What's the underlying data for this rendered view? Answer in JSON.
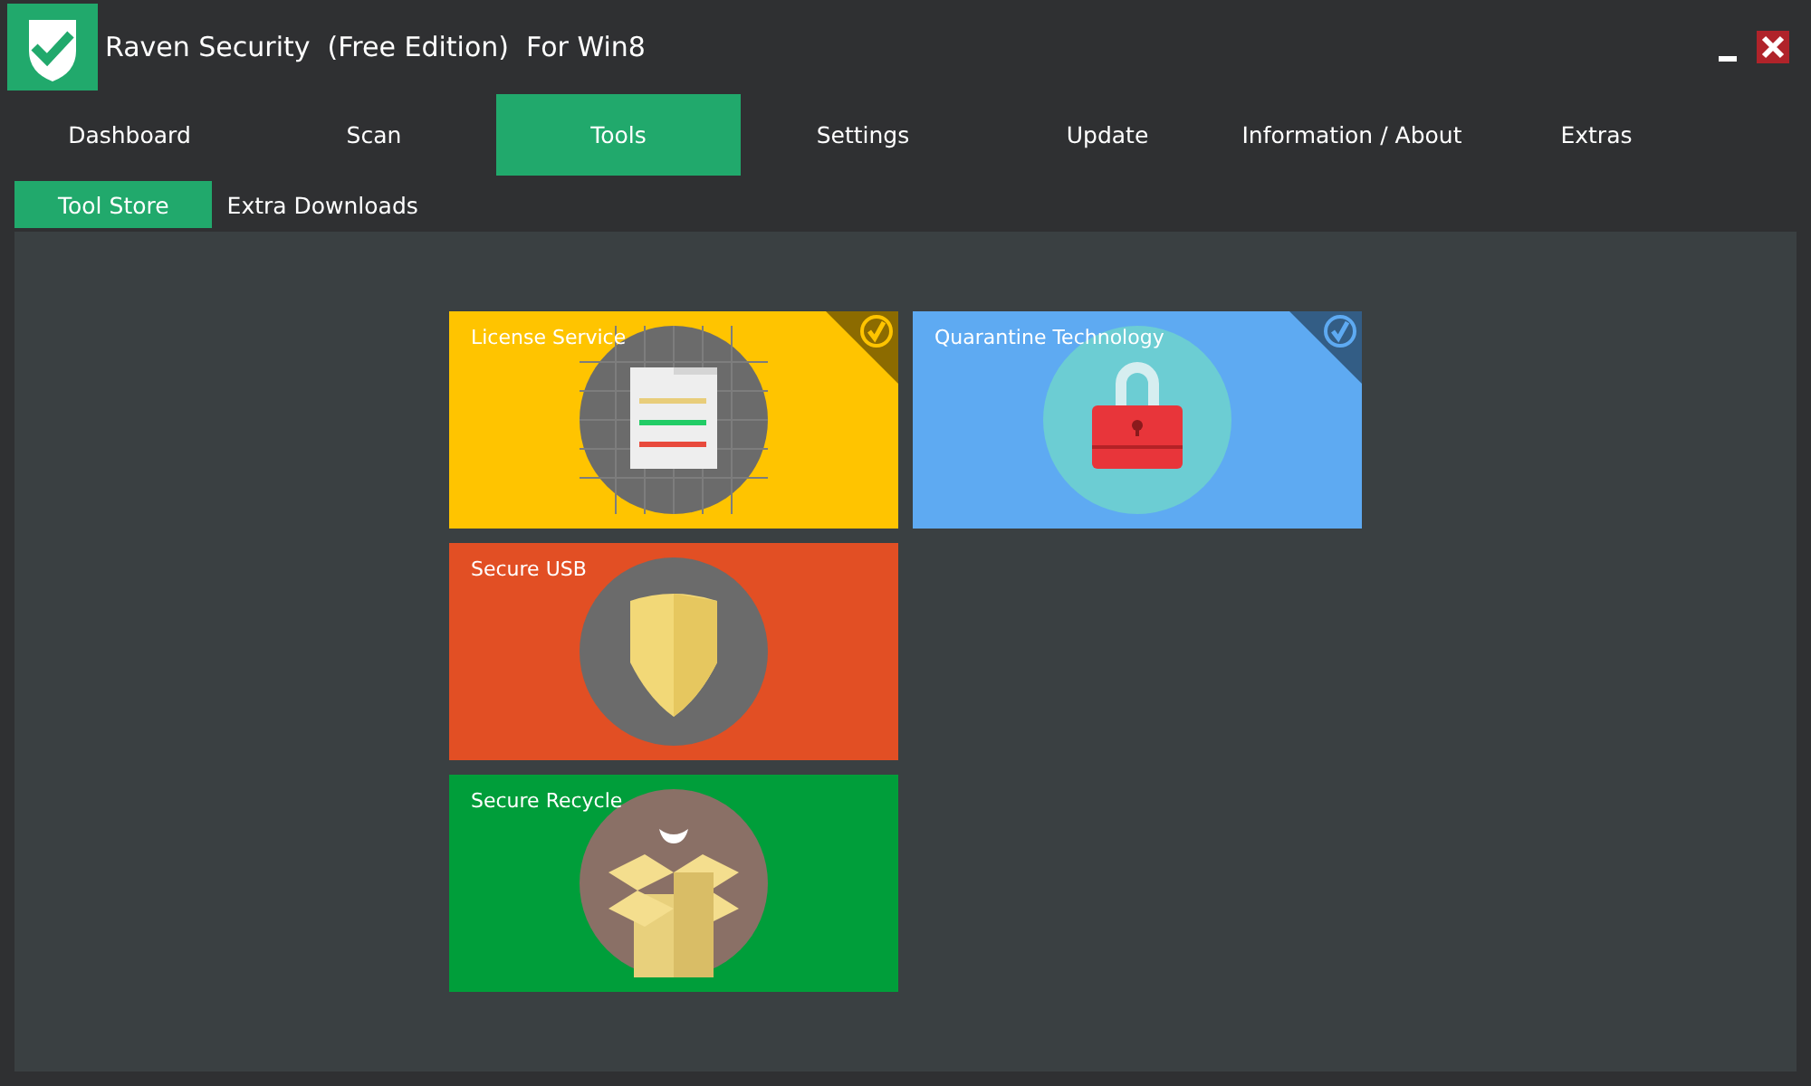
{
  "window": {
    "title": "Raven Security  (Free Edition)  For Win8"
  },
  "tabs": [
    {
      "label": "Dashboard",
      "selected": false
    },
    {
      "label": "Scan",
      "selected": false
    },
    {
      "label": "Tools",
      "selected": true
    },
    {
      "label": "Settings",
      "selected": false
    },
    {
      "label": "Update",
      "selected": false
    },
    {
      "label": "Information / About",
      "selected": false
    },
    {
      "label": "Extras",
      "selected": false
    }
  ],
  "subtabs": [
    {
      "label": "Tool Store",
      "selected": true
    },
    {
      "label": "Extra Downloads",
      "selected": false
    }
  ],
  "tiles": [
    [
      {
        "label": "License Service",
        "kind": "document",
        "color": "#ffc400",
        "installed": true
      },
      {
        "label": "Quarantine Technology",
        "kind": "padlock",
        "color": "#5eaaf2",
        "installed": true
      }
    ],
    [
      {
        "label": "Secure USB",
        "kind": "shield",
        "color": "#e24f24",
        "installed": false
      }
    ],
    [
      {
        "label": "Secure Recycle",
        "kind": "box",
        "color": "#009e3a",
        "installed": false
      }
    ]
  ]
}
